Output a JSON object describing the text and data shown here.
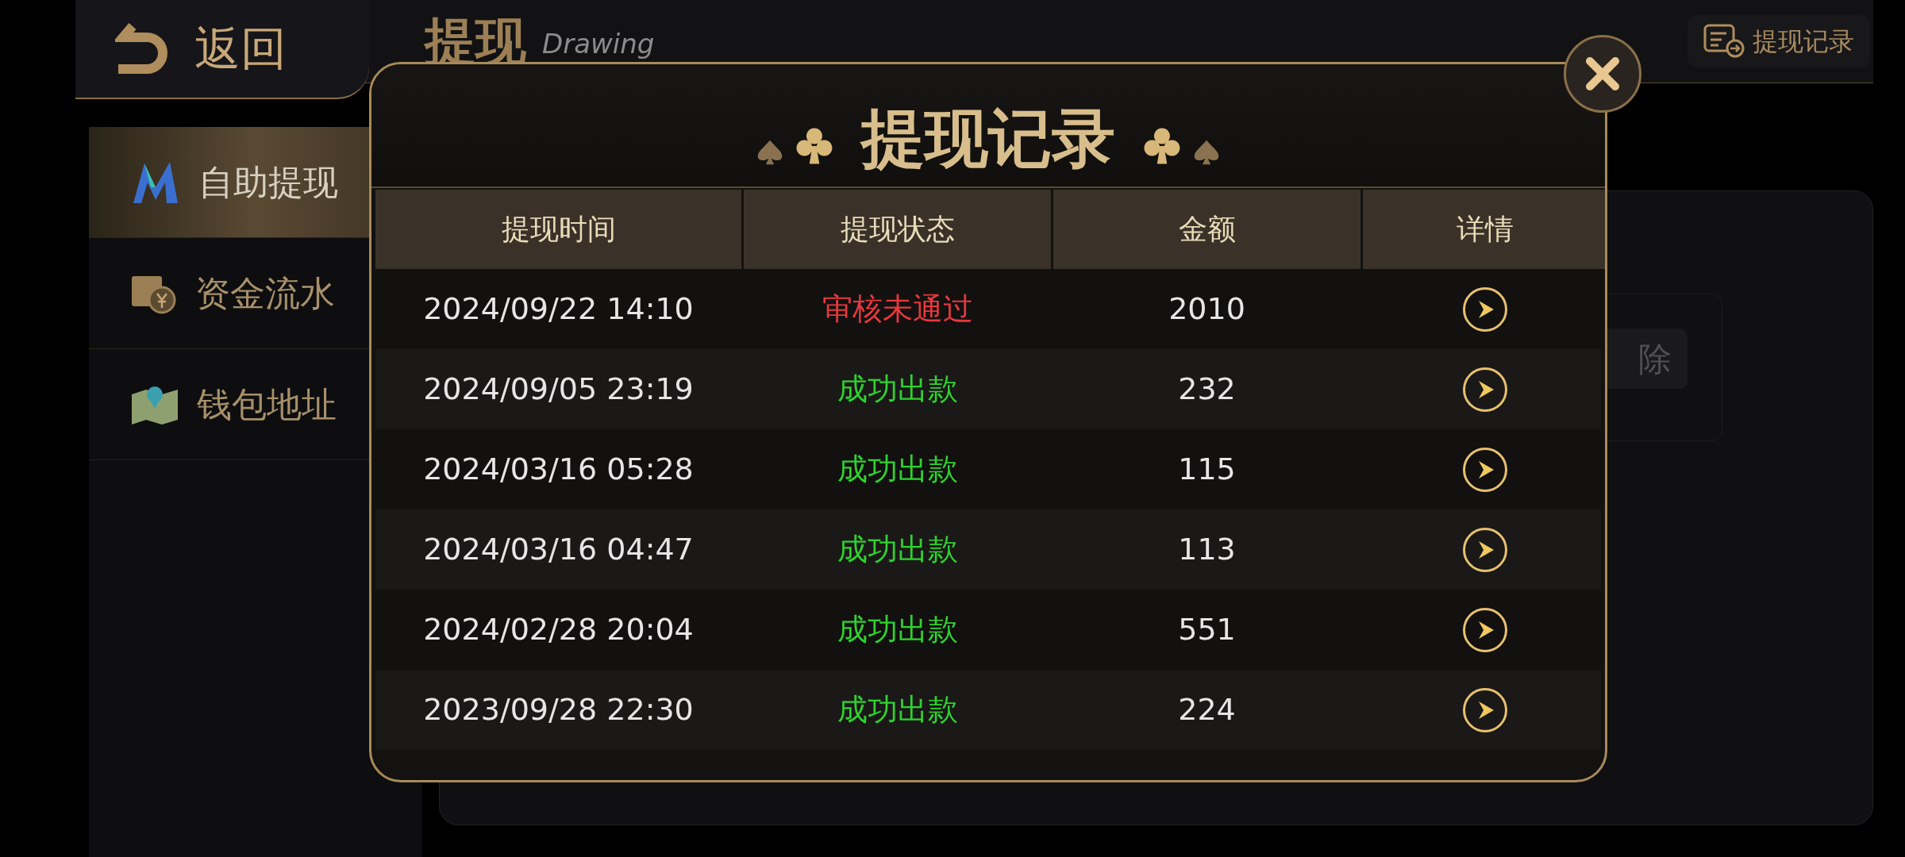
{
  "header": {
    "back_label": "返回",
    "title": "提现",
    "subtitle": "Drawing",
    "record_button": "提现记录"
  },
  "sidebar": {
    "items": [
      {
        "label": "自助提现",
        "kind": "logo",
        "selected": true
      },
      {
        "label": "资金流水",
        "kind": "money",
        "selected": false
      },
      {
        "label": "钱包地址",
        "kind": "map",
        "selected": false
      }
    ]
  },
  "background_panel": {
    "button_fragment": "除"
  },
  "dialog": {
    "title": "提现记录",
    "columns": [
      "提现时间",
      "提现状态",
      "金额",
      "详情"
    ],
    "rows": [
      {
        "time": "2024/09/22 14:10",
        "status": "审核未通过",
        "color": "#e8383d",
        "amount": "2010"
      },
      {
        "time": "2024/09/05 23:19",
        "status": "成功出款",
        "color": "#2fd22f",
        "amount": "232"
      },
      {
        "time": "2024/03/16 05:28",
        "status": "成功出款",
        "color": "#2fd22f",
        "amount": "115"
      },
      {
        "time": "2024/03/16 04:47",
        "status": "成功出款",
        "color": "#2fd22f",
        "amount": "113"
      },
      {
        "time": "2024/02/28 20:04",
        "status": "成功出款",
        "color": "#2fd22f",
        "amount": "551"
      },
      {
        "time": "2023/09/28 22:30",
        "status": "成功出款",
        "color": "#2fd22f",
        "amount": "224"
      }
    ]
  }
}
